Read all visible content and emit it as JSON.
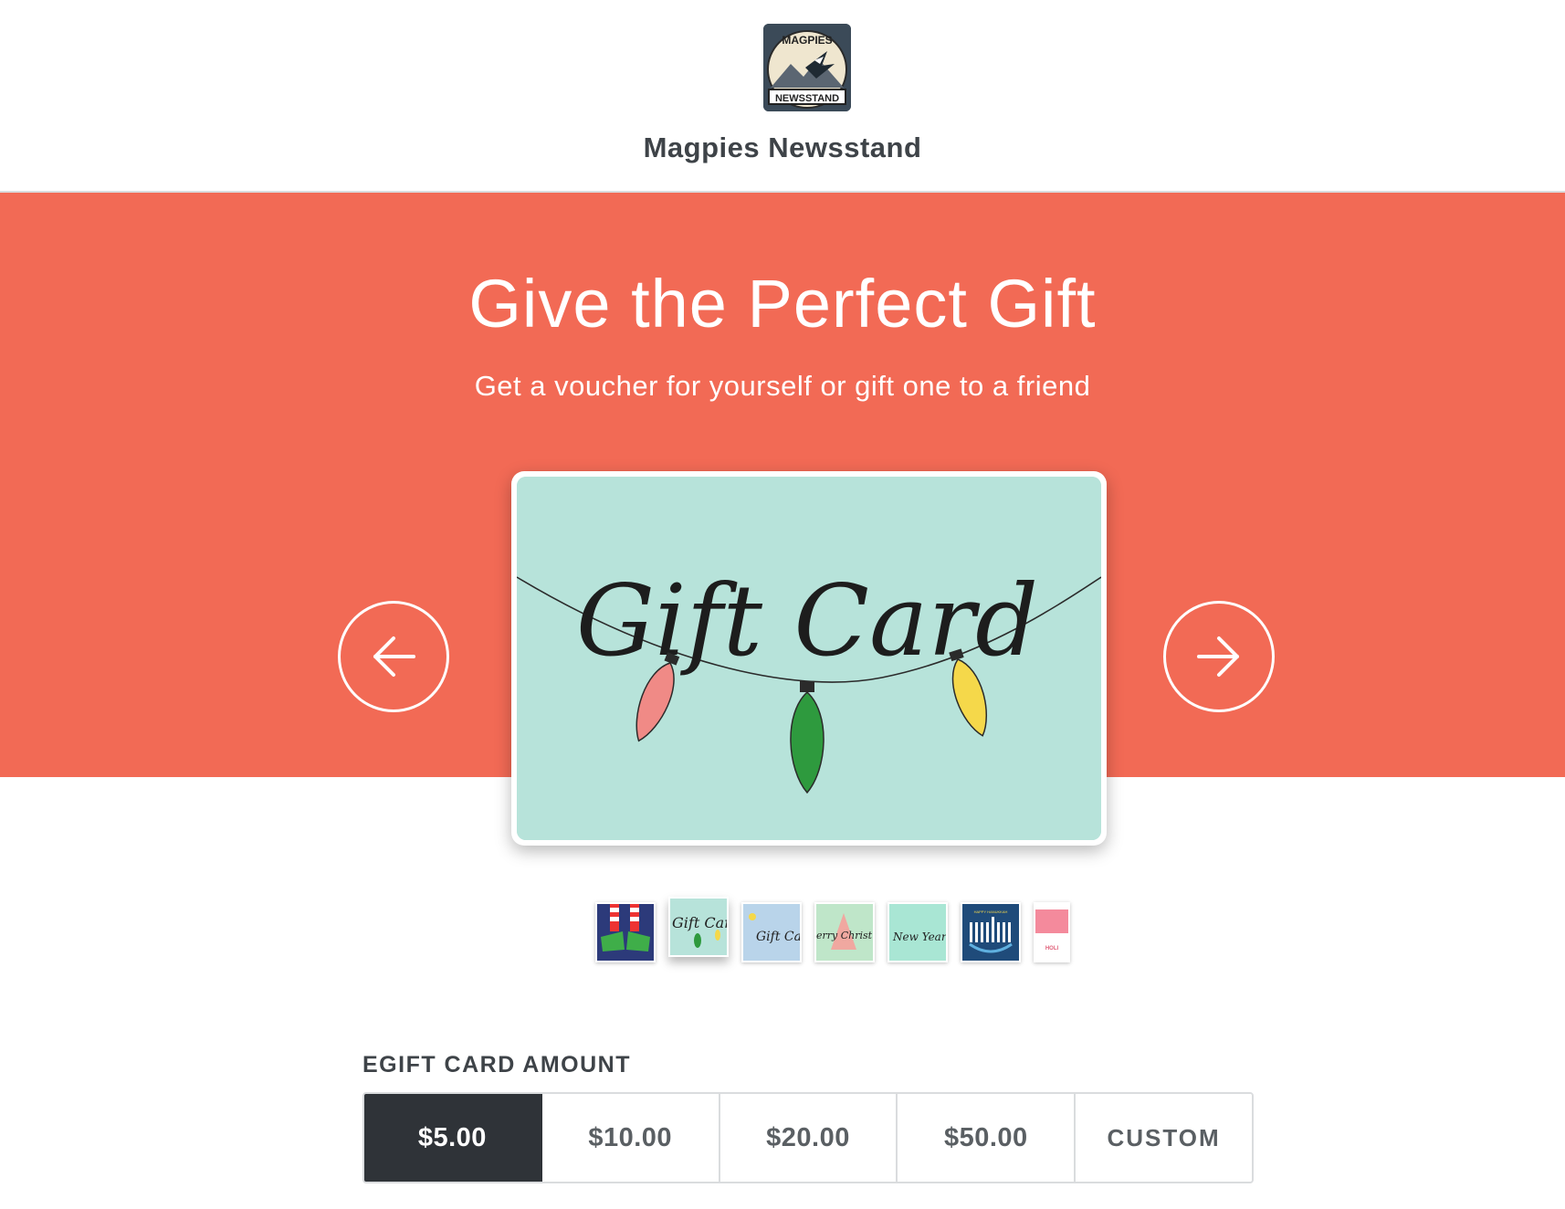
{
  "store": {
    "name": "Magpies Newsstand",
    "logo_text_top": "MAGPIES",
    "logo_text_bottom": "NEWSSTAND"
  },
  "hero": {
    "title": "Give the Perfect Gift",
    "subtitle": "Get a voucher for yourself or gift one to a friend",
    "background_color": "#f26a55"
  },
  "card": {
    "script_text": "Gift Card",
    "background_color": "#b7e3da"
  },
  "carousel": {
    "prev_icon": "arrow-left-icon",
    "next_icon": "arrow-right-icon",
    "thumbnails": [
      {
        "name": "elf-feet",
        "selected": false
      },
      {
        "name": "gift-card-lights",
        "label": "Gift Card",
        "selected": true
      },
      {
        "name": "gift-card-blue",
        "label": "Gift Ca",
        "selected": false
      },
      {
        "name": "merry-christmas",
        "label": "erry Christ",
        "selected": false
      },
      {
        "name": "happy-new-year",
        "label": "New Year",
        "selected": false
      },
      {
        "name": "happy-hanukkah",
        "label": "HAPPY HANUKKAH",
        "selected": false
      },
      {
        "name": "holiday",
        "label": "HOLI",
        "selected": false
      }
    ]
  },
  "amount": {
    "label": "EGIFT CARD AMOUNT",
    "options": [
      "$5.00",
      "$10.00",
      "$20.00",
      "$50.00",
      "CUSTOM"
    ],
    "selected": "$5.00"
  }
}
